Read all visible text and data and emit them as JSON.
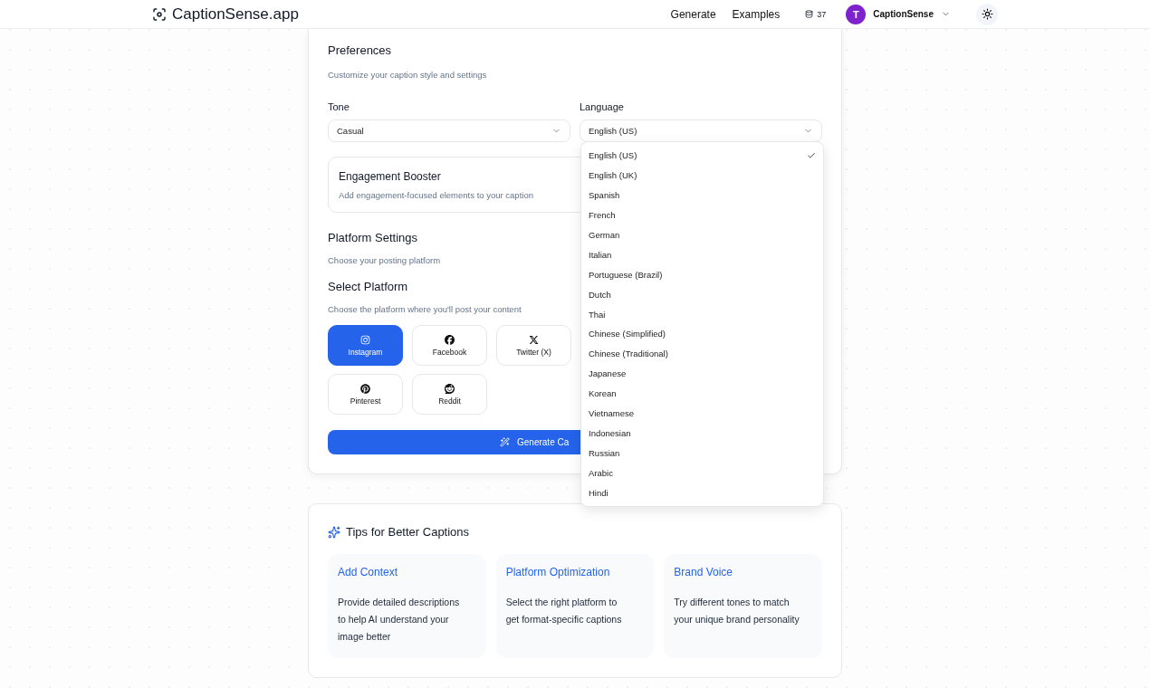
{
  "header": {
    "logo": "CaptionSense.app",
    "nav": [
      "Generate",
      "Examples"
    ],
    "credits": "37",
    "avatar_initial": "T",
    "account": "CaptionSense"
  },
  "preferences": {
    "title": "Preferences",
    "subtitle": "Customize your caption style and settings",
    "tone": {
      "label": "Tone",
      "value": "Casual"
    },
    "language": {
      "label": "Language",
      "value": "English (US)",
      "expanded": true,
      "options": [
        {
          "label": "English (US)",
          "selected": true
        },
        {
          "label": "English (UK)",
          "selected": false
        },
        {
          "label": "Spanish",
          "selected": false
        },
        {
          "label": "French",
          "selected": false
        },
        {
          "label": "German",
          "selected": false
        },
        {
          "label": "Italian",
          "selected": false
        },
        {
          "label": "Portuguese (Brazil)",
          "selected": false
        },
        {
          "label": "Dutch",
          "selected": false
        },
        {
          "label": "Thai",
          "selected": false
        },
        {
          "label": "Chinese (Simplified)",
          "selected": false
        },
        {
          "label": "Chinese (Traditional)",
          "selected": false
        },
        {
          "label": "Japanese",
          "selected": false
        },
        {
          "label": "Korean",
          "selected": false
        },
        {
          "label": "Vietnamese",
          "selected": false
        },
        {
          "label": "Indonesian",
          "selected": false
        },
        {
          "label": "Russian",
          "selected": false
        },
        {
          "label": "Arabic",
          "selected": false
        },
        {
          "label": "Hindi",
          "selected": false
        }
      ]
    },
    "booster": {
      "title": "Engagement Booster",
      "description": "Add engagement-focused elements to your caption"
    },
    "platform_settings": {
      "title": "Platform Settings",
      "subtitle": "Choose your posting platform"
    },
    "select_platform": {
      "title": "Select Platform",
      "subtitle": "Choose the platform where you'll post your content"
    },
    "platforms": [
      {
        "kind": "instagram",
        "label": "Instagram",
        "selected": true
      },
      {
        "kind": "facebook",
        "label": "Facebook",
        "selected": false
      },
      {
        "kind": "x",
        "label": "Twitter (X)",
        "selected": false
      },
      {
        "kind": "pinterest",
        "label": "Pinterest",
        "selected": false
      },
      {
        "kind": "reddit",
        "label": "Reddit",
        "selected": false
      }
    ],
    "generate_button": "Generate Ca"
  },
  "tips": {
    "title": "Tips for Better Captions",
    "cards": [
      {
        "title": "Add Context",
        "text": "Provide detailed descriptions to help AI understand your image better"
      },
      {
        "title": "Platform Optimization",
        "text": "Select the right platform to get format-specific captions"
      },
      {
        "title": "Brand Voice",
        "text": "Try different tones to match your unique brand personality"
      }
    ]
  }
}
